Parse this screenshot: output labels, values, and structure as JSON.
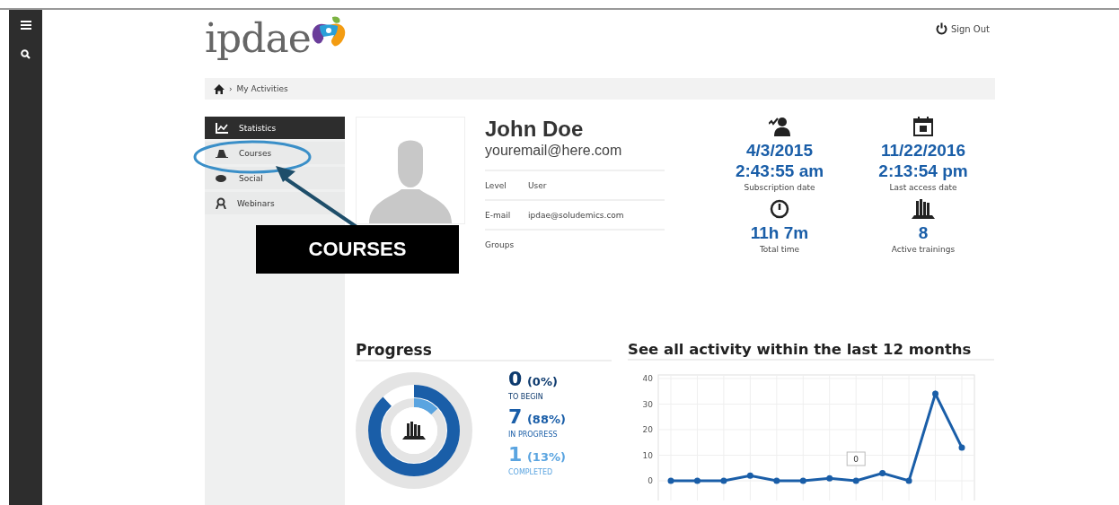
{
  "logo": {
    "text": "ipdae"
  },
  "header": {
    "sign_out": "Sign Out"
  },
  "breadcrumb": {
    "separator": "›",
    "items": [
      "My Activities"
    ]
  },
  "menu": [
    {
      "label": "Statistics",
      "selected": true
    },
    {
      "label": "Courses",
      "selected": false
    },
    {
      "label": "Social",
      "selected": false
    },
    {
      "label": "Webinars",
      "selected": false
    }
  ],
  "annotation": {
    "label": "COURSES"
  },
  "profile": {
    "name": "John Doe",
    "email": "youremail@here.com",
    "fields": [
      {
        "label": "Level",
        "value": "User"
      },
      {
        "label": "E-mail",
        "value": "ipdae@soludemics.com"
      },
      {
        "label": "Groups"
      }
    ]
  },
  "stats": [
    {
      "kind": "subscription",
      "value": [
        "4/3/2015",
        "2:43:55 am"
      ],
      "label": "Subscription date"
    },
    {
      "kind": "access",
      "value": [
        "11/22/2016",
        "2:13:54 pm"
      ],
      "label": "Last access date"
    },
    {
      "kind": "time",
      "value": [
        "11h 7m"
      ],
      "label": "Total time"
    },
    {
      "kind": "trainings",
      "value": [
        "8"
      ],
      "label": "Active trainings"
    }
  ],
  "progress": {
    "title": "Progress",
    "items": [
      {
        "count": "0",
        "percent": "(0%)",
        "label": "TO BEGIN"
      },
      {
        "count": "7",
        "percent": "(88%)",
        "label": "IN PROGRESS",
        "level": 0.88
      },
      {
        "count": "1",
        "percent": "(13%)",
        "label": "COMPLETED",
        "level": 0.13
      }
    ]
  },
  "activity": {
    "title": "See all activity within the last 12 months",
    "tooltip": "0",
    "chart_data": {
      "type": "line",
      "ylim": [
        0,
        40
      ],
      "yticks": [
        0,
        10,
        20,
        30,
        40
      ],
      "grid": true,
      "series": [
        {
          "color": "#1a5ea8",
          "marker": true,
          "values": [
            0,
            0,
            0,
            2,
            0,
            0,
            1,
            0,
            3,
            0,
            34,
            13
          ]
        }
      ]
    }
  }
}
